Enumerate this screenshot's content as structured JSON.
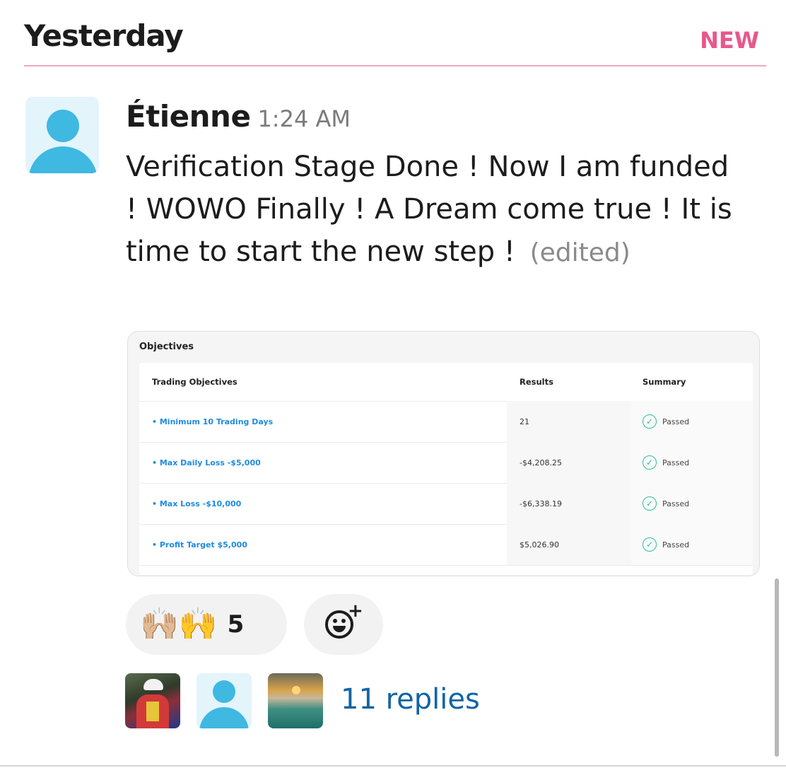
{
  "day_header": {
    "title": "Yesterday",
    "new_label": "NEW",
    "accent_color": "#e8588a"
  },
  "message": {
    "author": "Étienne",
    "time": "1:24 AM",
    "text": "Verification Stage Done ! Now I am funded !  WOWO Finally ! A Dream come true ! It is time to start the new step ! ",
    "edited_label": "(edited)"
  },
  "attachment": {
    "title": "Objectives",
    "columns": [
      "Trading Objectives",
      "Results",
      "Summary"
    ],
    "rows": [
      {
        "objective": "• Minimum 10 Trading Days",
        "result": "21",
        "summary": "Passed"
      },
      {
        "objective": "• Max Daily Loss -$5,000",
        "result": "-$4,208.25",
        "summary": "Passed"
      },
      {
        "objective": "• Max Loss -$10,000",
        "result": "-$6,338.19",
        "summary": "Passed"
      },
      {
        "objective": "• Profit Target $5,000",
        "result": "$5,026.90",
        "summary": "Passed"
      }
    ]
  },
  "reactions": [
    {
      "emoji": "🙌🏼🙌",
      "icon": "raising-hands-icon",
      "count": "5"
    }
  ],
  "add_reaction": {
    "icon": "add-emoji-icon"
  },
  "thread": {
    "replies_label": "11 replies",
    "link_color": "#1264a3"
  }
}
